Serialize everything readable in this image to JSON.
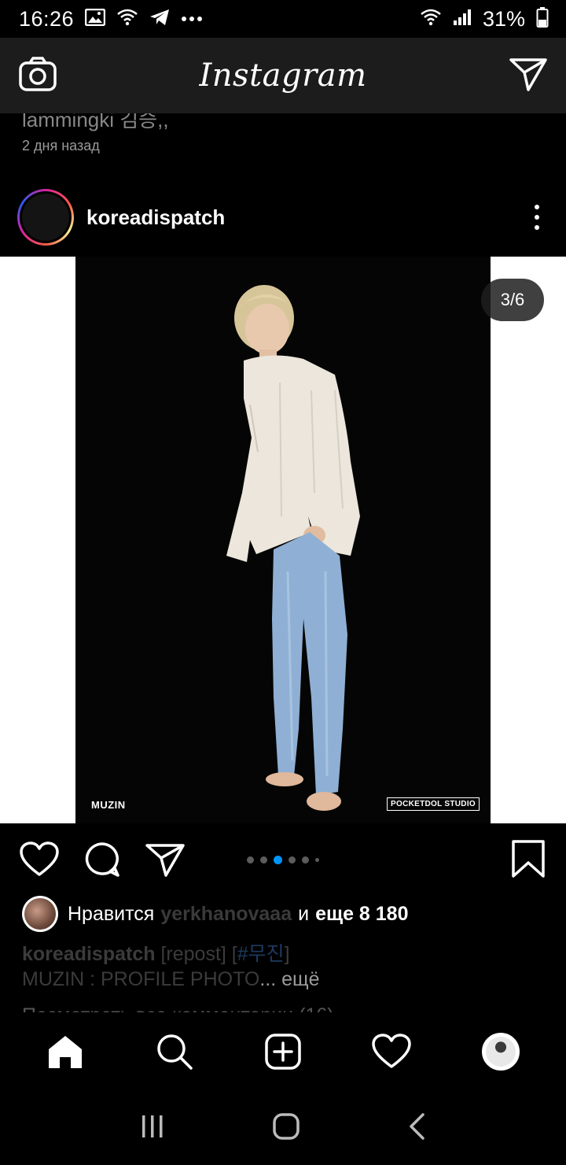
{
  "status_bar": {
    "time": "16:26",
    "battery": "31%",
    "icons_left": [
      "gallery-icon",
      "wifi-icon",
      "telegram-icon",
      "more-notifications-icon"
    ],
    "icons_right": [
      "wifi-icon",
      "signal-icon",
      "battery-icon"
    ]
  },
  "header": {
    "logo": "Instagram",
    "left_icon": "camera-icon",
    "right_icon": "direct-message-icon"
  },
  "previous_post": {
    "caption_fragment": "lammingki 김승,,",
    "time_ago": "2 дня назад"
  },
  "post": {
    "username": "koreadispatch",
    "counter": "3/6",
    "watermark_left": "MUZIN",
    "watermark_right": "POCKETDOL STUDIO",
    "carousel": {
      "total": 6,
      "current": 3
    },
    "likes": {
      "prefix": "Нравится",
      "liker": "yerkhanovaaa",
      "joiner": "и",
      "others": "еще 8 180"
    },
    "caption": {
      "username": "koreadispatch",
      "repost": "[repost]",
      "hashtag_open": "[",
      "hashtag": "#무진",
      "hashtag_close": "]",
      "text": "MUZIN : PROFILE PHOTO",
      "more": "... ещё"
    },
    "comments_link": "Посмотреть все комментарии (16)"
  },
  "colors": {
    "accent_blue": "#0095f6",
    "header_bg": "#1c1c1c",
    "background": "#000000"
  },
  "bottom_nav": [
    "home-icon",
    "search-icon",
    "new-post-icon",
    "activity-heart-icon",
    "profile-avatar"
  ],
  "system_nav": [
    "recent-apps-icon",
    "home-button-icon",
    "back-icon"
  ]
}
